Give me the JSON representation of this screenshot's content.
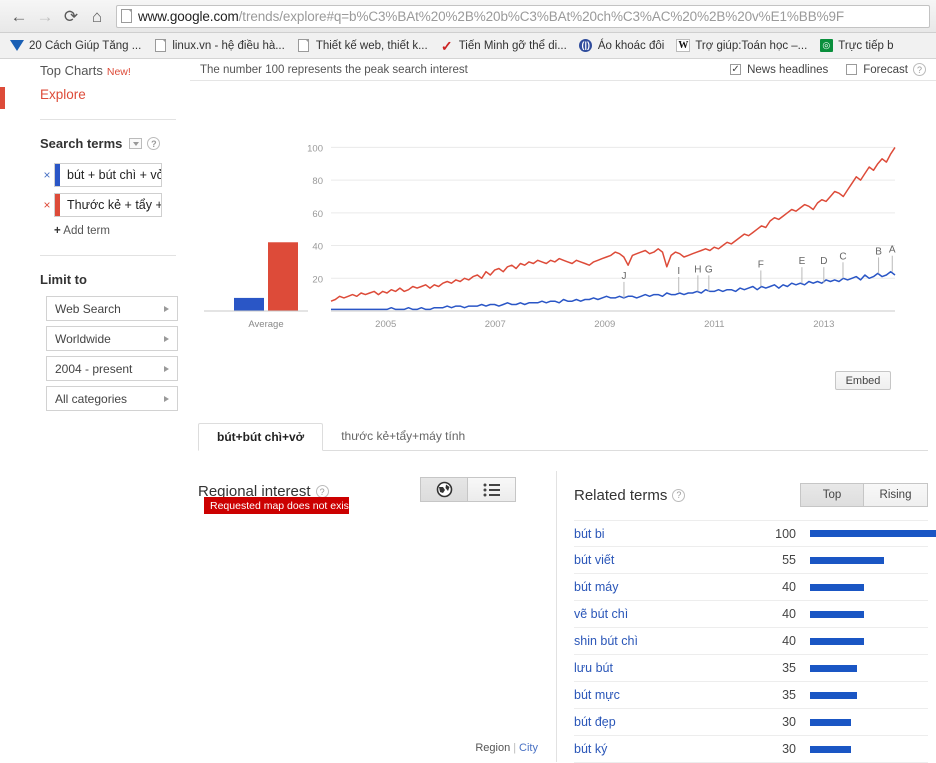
{
  "browser": {
    "nav": {
      "back_icon": "back-arrow-icon",
      "forward_icon": "forward-arrow-icon",
      "reload_icon": "reload-icon",
      "home_icon": "home-icon"
    },
    "url": {
      "domain": "www.google.com",
      "path": "/trends/explore#q=b%C3%BAt%20%2B%20b%C3%BAt%20ch%C3%AC%20%2B%20v%E1%BB%9F"
    },
    "bookmarks": [
      {
        "label": "20 Cách Giúp Tăng ...",
        "icon": "blue-triangle-icon"
      },
      {
        "label": "linux.vn - hệ điều hà...",
        "icon": "page-icon"
      },
      {
        "label": "Thiết kế web, thiết k...",
        "icon": "page-icon"
      },
      {
        "label": "Tiến Minh gỡ thể di...",
        "icon": "red-check-icon"
      },
      {
        "label": "Áo khoác đôi",
        "icon": "blue-circle-icon"
      },
      {
        "label": "Trợ giúp:Toán học –...",
        "icon": "wikipedia-icon"
      },
      {
        "label": "Trực tiếp b",
        "icon": "green-square-icon"
      }
    ]
  },
  "sidebar": {
    "top_charts": {
      "label": "Top Charts",
      "badge": "New!"
    },
    "explore": "Explore",
    "search_terms": {
      "heading": "Search terms",
      "help_icon": "help-icon",
      "filter_icon": "chevron-down-icon",
      "terms": [
        {
          "text": "bút + bút chì + vở",
          "color": "#2a56c6",
          "remove_icon": "close-icon"
        },
        {
          "text": "Thước kẻ + tẩy +",
          "color": "#dd4b39",
          "remove_icon": "close-icon"
        }
      ],
      "add_term": "Add term",
      "add_plus": "+"
    },
    "limit_to": {
      "heading": "Limit to",
      "options": [
        "Web Search",
        "Worldwide",
        "2004 - present",
        "All categories"
      ]
    }
  },
  "chart_header": {
    "note": "The number 100 represents the peak search interest",
    "news_headlines": {
      "label": "News headlines",
      "checked": true,
      "mark": "✓"
    },
    "forecast": {
      "label": "Forecast",
      "checked": false,
      "mark": ""
    },
    "help_icon": "help-icon"
  },
  "embed_button": "Embed",
  "tabs": [
    {
      "label": "bút+bút chì+vở",
      "active": true
    },
    {
      "label": "thước kẻ+tẩy+máy tính",
      "active": false
    }
  ],
  "regional": {
    "title": "Regional interest",
    "help_icon": "help-icon",
    "error": "Requested map does not exist.",
    "error_close": "×",
    "view_toggle": [
      {
        "icon": "globe-icon",
        "active": true
      },
      {
        "icon": "list-icon",
        "active": false
      }
    ],
    "footer": {
      "region": "Region",
      "separator": "|",
      "city": "City"
    }
  },
  "related": {
    "title": "Related terms",
    "help_icon": "help-icon",
    "toggle": [
      {
        "label": "Top",
        "active": true
      },
      {
        "label": "Rising",
        "active": false
      }
    ],
    "terms": [
      {
        "name": "bút bi",
        "value": 100
      },
      {
        "name": "bút viết",
        "value": 55
      },
      {
        "name": "bút máy",
        "value": 40
      },
      {
        "name": "vẽ bút chì",
        "value": 40
      },
      {
        "name": "shin bút chì",
        "value": 40
      },
      {
        "name": "lưu bút",
        "value": 35
      },
      {
        "name": "bút mực",
        "value": 35
      },
      {
        "name": "bút đẹp",
        "value": 30
      },
      {
        "name": "bút ký",
        "value": 30
      }
    ],
    "bar_color": "#1a56c4",
    "max_value": 100
  },
  "chart_data": {
    "type": "line",
    "title": "",
    "xlabel": "",
    "ylabel": "",
    "ylim": [
      0,
      110
    ],
    "yticks": [
      20,
      40,
      60,
      80,
      100
    ],
    "xticks": [
      "2005",
      "2007",
      "2009",
      "2011",
      "2013"
    ],
    "grid": true,
    "legend": "none",
    "average_bars": {
      "label": "Average",
      "series": [
        {
          "name": "bút+bút chì+vở",
          "value": 8,
          "color": "#2a56c6"
        },
        {
          "name": "thước kẻ+tẩy+máy tính",
          "value": 42,
          "color": "#dd4b39"
        }
      ]
    },
    "x_start": 2004.0,
    "x_end": 2014.3,
    "series": [
      {
        "name": "bút+bút chì+vở",
        "color": "#2a56c6",
        "values": [
          1,
          1,
          1,
          1,
          1,
          1,
          1,
          1,
          1,
          1,
          1,
          1,
          1,
          1,
          2,
          1,
          1,
          1,
          2,
          1,
          1,
          2,
          1,
          1,
          2,
          2,
          2,
          3,
          2,
          3,
          3,
          2,
          3,
          3,
          3,
          4,
          3,
          4,
          4,
          3,
          4,
          5,
          4,
          4,
          5,
          4,
          5,
          5,
          5,
          6,
          5,
          6,
          6,
          5,
          7,
          6,
          6,
          7,
          6,
          7,
          7,
          8,
          7,
          8,
          9,
          8,
          8,
          9,
          8,
          9,
          9,
          8,
          9,
          10,
          9,
          10,
          10,
          9,
          11,
          10,
          10,
          11,
          10,
          11,
          11,
          12,
          11,
          13,
          12,
          12,
          13,
          12,
          13,
          13,
          12,
          14,
          13,
          14,
          15,
          13,
          15,
          14,
          15,
          16,
          14,
          16,
          15,
          17,
          16,
          17,
          16,
          18,
          17,
          18,
          17,
          19,
          18,
          19,
          18,
          20,
          19,
          20,
          21,
          19,
          22,
          20,
          21,
          23,
          21,
          22,
          24,
          22
        ]
      },
      {
        "name": "thước kẻ+tẩy+máy tính",
        "color": "#dd4b39",
        "values": [
          6,
          7,
          9,
          8,
          9,
          10,
          9,
          11,
          10,
          11,
          12,
          10,
          12,
          11,
          13,
          12,
          14,
          12,
          13,
          15,
          14,
          15,
          16,
          14,
          16,
          15,
          17,
          18,
          17,
          19,
          18,
          20,
          19,
          21,
          22,
          20,
          24,
          22,
          25,
          26,
          24,
          27,
          28,
          26,
          29,
          28,
          30,
          29,
          31,
          30,
          29,
          31,
          30,
          32,
          31,
          30,
          29,
          31,
          30,
          29,
          28,
          30,
          31,
          32,
          33,
          34,
          36,
          35,
          33,
          28,
          34,
          35,
          36,
          37,
          35,
          36,
          38,
          36,
          27,
          34,
          36,
          35,
          33,
          34,
          35,
          36,
          37,
          38,
          37,
          39,
          38,
          40,
          42,
          41,
          43,
          45,
          47,
          46,
          48,
          50,
          52,
          51,
          55,
          57,
          56,
          58,
          60,
          62,
          61,
          63,
          65,
          64,
          62,
          66,
          68,
          67,
          70,
          73,
          72,
          70,
          74,
          78,
          82,
          80,
          84,
          88,
          86,
          90,
          93,
          91,
          96,
          100
        ]
      }
    ],
    "news_markers": [
      {
        "letter": "J",
        "x": 2009.35
      },
      {
        "letter": "I",
        "x": 2010.35
      },
      {
        "letter": "H",
        "x": 2010.7
      },
      {
        "letter": "G",
        "x": 2010.9
      },
      {
        "letter": "F",
        "x": 2011.85
      },
      {
        "letter": "E",
        "x": 2012.6
      },
      {
        "letter": "D",
        "x": 2013.0
      },
      {
        "letter": "C",
        "x": 2013.35
      },
      {
        "letter": "B",
        "x": 2014.0
      },
      {
        "letter": "A",
        "x": 2014.25
      }
    ]
  }
}
